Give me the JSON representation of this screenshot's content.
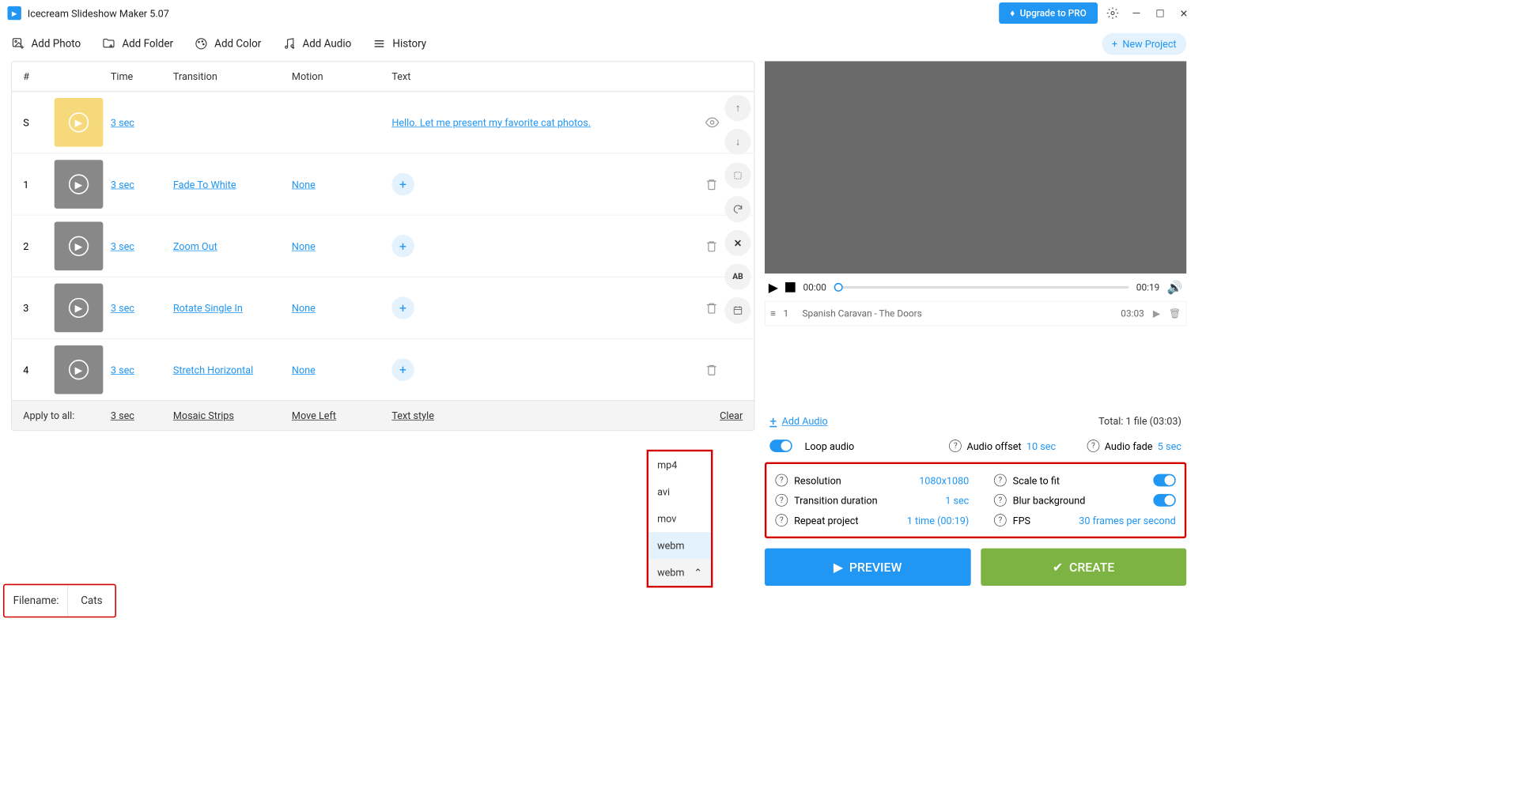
{
  "app": {
    "title": "Icecream Slideshow Maker 5.07",
    "upgrade": "Upgrade to PRO"
  },
  "toolbar": {
    "add_photo": "Add Photo",
    "add_folder": "Add Folder",
    "add_color": "Add Color",
    "add_audio": "Add Audio",
    "history": "History",
    "new_project": "New Project"
  },
  "table": {
    "headers": {
      "num": "#",
      "time": "Time",
      "transition": "Transition",
      "motion": "Motion",
      "text": "Text"
    },
    "rows": [
      {
        "num": "S",
        "time": "3 sec",
        "transition": "",
        "motion": "",
        "text": "Hello. Let me present my favorite cat photos.",
        "action": "eye"
      },
      {
        "num": "1",
        "time": "3 sec",
        "transition": "Fade To White",
        "motion": "None",
        "text": "",
        "action": "delete"
      },
      {
        "num": "2",
        "time": "3 sec",
        "transition": "Zoom Out",
        "motion": "None",
        "text": "",
        "action": "delete"
      },
      {
        "num": "3",
        "time": "3 sec",
        "transition": "Rotate Single In",
        "motion": "None",
        "text": "",
        "action": "delete"
      },
      {
        "num": "4",
        "time": "3 sec",
        "transition": "Stretch Horizontal",
        "motion": "None",
        "text": "",
        "action": "delete"
      }
    ],
    "apply": {
      "label": "Apply to all:",
      "time": "3 sec",
      "transition": "Mosaic Strips",
      "motion": "Move Left",
      "text": "Text style",
      "clear": "Clear"
    }
  },
  "filename": {
    "label": "Filename:",
    "value": "Cats"
  },
  "format": {
    "options": [
      "mp4",
      "avi",
      "mov",
      "webm"
    ],
    "selected": "webm",
    "highlighted": "webm"
  },
  "preview": {
    "current_time": "00:00",
    "total_time": "00:19"
  },
  "audio": {
    "track_num": "1",
    "track_name": "Spanish Caravan - The Doors",
    "track_duration": "03:03",
    "add_audio": "Add Audio",
    "total": "Total: 1 file (03:03)",
    "loop": "Loop audio",
    "offset_label": "Audio offset",
    "offset_val": "10 sec",
    "fade_label": "Audio fade",
    "fade_val": "5 sec"
  },
  "settings": {
    "resolution_label": "Resolution",
    "resolution_val": "1080x1080",
    "scale_label": "Scale to fit",
    "transition_label": "Transition duration",
    "transition_val": "1 sec",
    "blur_label": "Blur background",
    "repeat_label": "Repeat project",
    "repeat_val": "1 time (00:19)",
    "fps_label": "FPS",
    "fps_val": "30 frames per second"
  },
  "buttons": {
    "preview": "PREVIEW",
    "create": "CREATE"
  }
}
